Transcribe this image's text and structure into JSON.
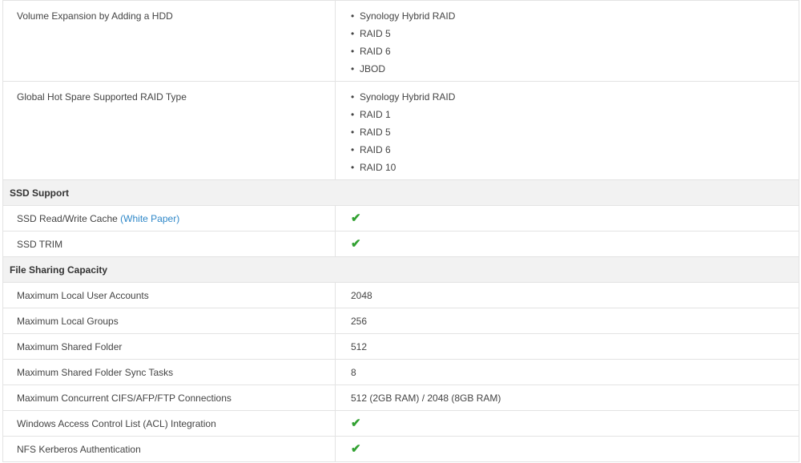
{
  "rows_top": [
    {
      "label": "Volume Expansion by Adding a HDD",
      "values": [
        "Synology Hybrid RAID",
        "RAID 5",
        "RAID 6",
        "JBOD"
      ]
    },
    {
      "label": "Global Hot Spare Supported RAID Type",
      "values": [
        "Synology Hybrid RAID",
        "RAID 1",
        "RAID 5",
        "RAID 6",
        "RAID 10"
      ]
    }
  ],
  "ssd": {
    "heading": "SSD Support",
    "cache_label": "SSD Read/Write Cache ",
    "cache_link_open": "(",
    "cache_link": "White Paper",
    "cache_link_close": ")",
    "trim_label": "SSD TRIM",
    "check_glyph": "✔"
  },
  "fsc": {
    "heading": "File Sharing Capacity",
    "rows": [
      {
        "label": "Maximum Local User Accounts",
        "value": "2048"
      },
      {
        "label": "Maximum Local Groups",
        "value": "256"
      },
      {
        "label": "Maximum Shared Folder",
        "value": "512"
      },
      {
        "label": "Maximum Shared Folder Sync Tasks",
        "value": "8"
      },
      {
        "label": "Maximum Concurrent CIFS/AFP/FTP Connections",
        "value": "512 (2GB RAM) / 2048 (8GB RAM)"
      }
    ],
    "acl_label": "Windows Access Control List (ACL) Integration",
    "nfs_label": "NFS Kerberos Authentication"
  },
  "colors": {
    "check": "#31a131",
    "link": "#2e87c8",
    "section_bg": "#f2f2f2",
    "border": "#e3e3e3"
  },
  "icons": {
    "bullet": "•",
    "check": "check-icon"
  }
}
